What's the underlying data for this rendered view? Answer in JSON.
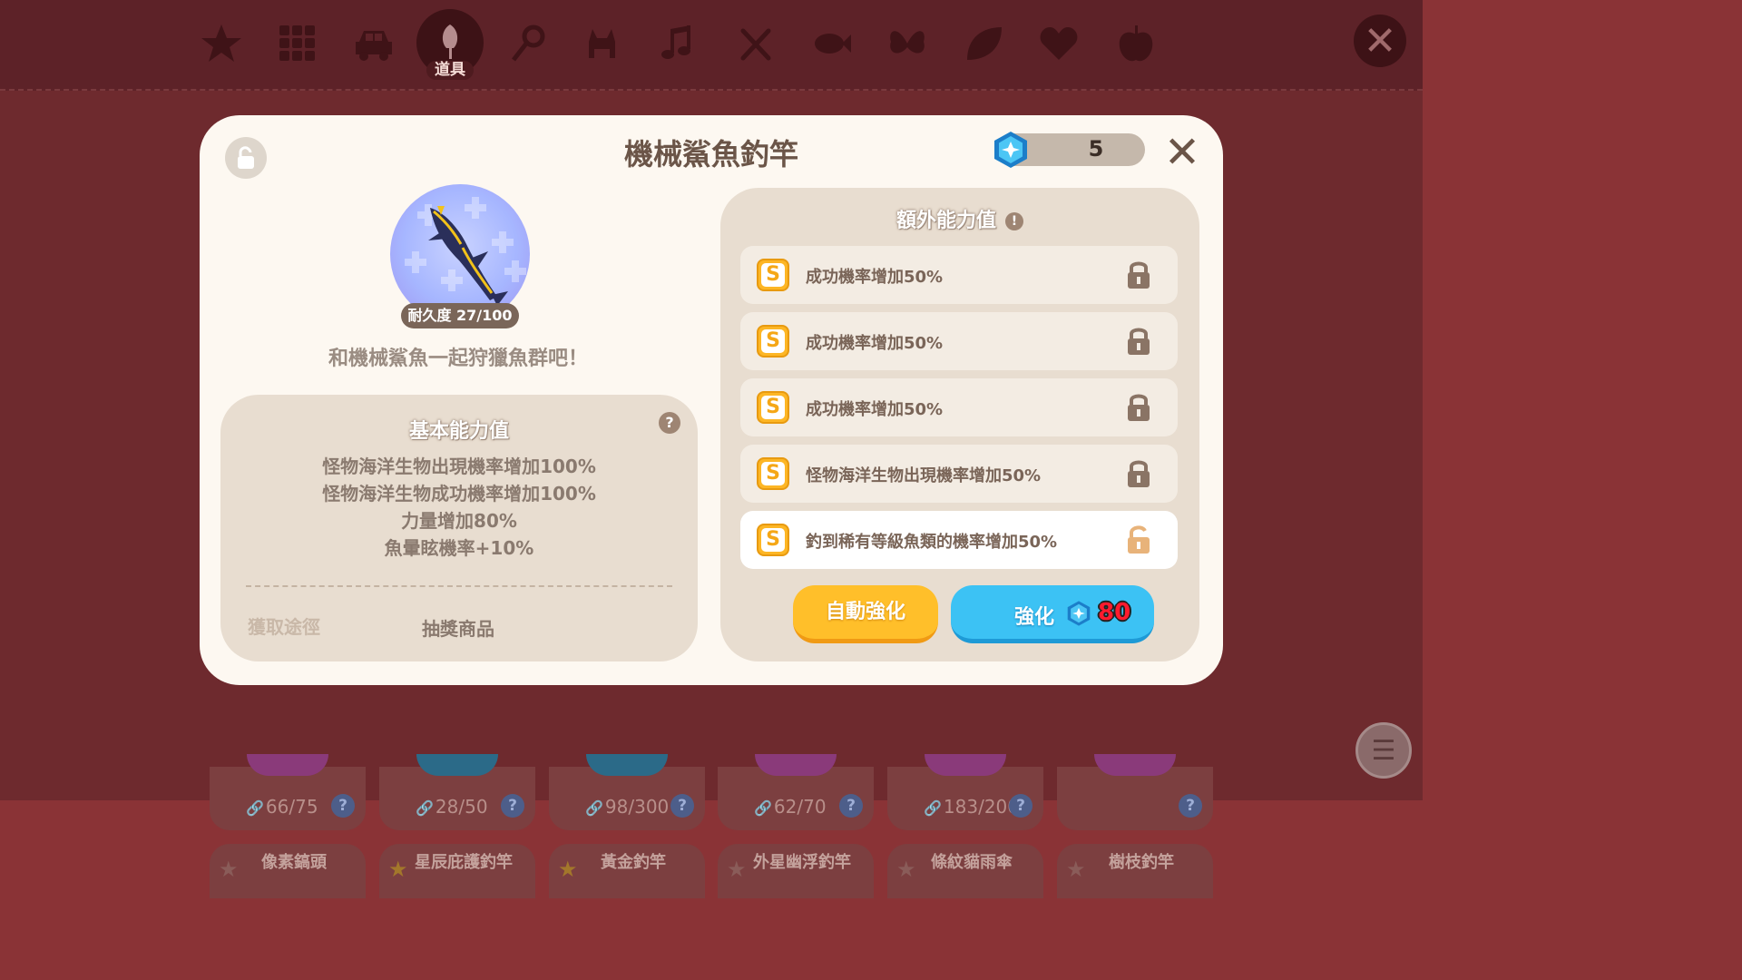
{
  "categories": {
    "active_label": "道具"
  },
  "inventory": {
    "cards": [
      {
        "durability": "66/75",
        "orb_color": "#8a3a7a"
      },
      {
        "durability": "28/50",
        "orb_color": "#2b6a88"
      },
      {
        "durability": "98/300",
        "orb_color": "#2b6a88"
      },
      {
        "durability": "62/70",
        "orb_color": "#8a3a7a"
      },
      {
        "durability": "183/200",
        "orb_color": "#8a3a7a"
      },
      {
        "durability": "",
        "orb_color": "#8a3a7a"
      }
    ],
    "names": [
      {
        "label": "像素鎬頭",
        "star": "gray"
      },
      {
        "label": "星辰庇護釣竿",
        "star": "gold"
      },
      {
        "label": "黃金釣竿",
        "star": "gold"
      },
      {
        "label": "外星幽浮釣竿",
        "star": "gray"
      },
      {
        "label": "條紋貓雨傘",
        "star": "gray"
      },
      {
        "label": "樹枝釣竿",
        "star": "gray"
      }
    ],
    "help_icon": "?"
  },
  "modal": {
    "title": "機械鯊魚釣竿",
    "gem_count": "5",
    "durability": "耐久度 27/100",
    "tagline": "和機械鯊魚一起狩獵魚群吧！",
    "basic": {
      "title": "基本能力值",
      "help": "?",
      "stats": [
        "怪物海洋生物出現機率增加100%",
        "怪物海洋生物成功機率增加100%",
        "力量增加80%",
        "魚暈眩機率+10%"
      ],
      "source_label": "獲取途徑",
      "source_value": "抽獎商品"
    },
    "extra": {
      "title": "額外能力值",
      "warn": "!",
      "rows": [
        {
          "grade": "S",
          "text": "成功機率增加50%",
          "locked": true
        },
        {
          "grade": "S",
          "text": "成功機率增加50%",
          "locked": true
        },
        {
          "grade": "S",
          "text": "成功機率增加50%",
          "locked": true
        },
        {
          "grade": "S",
          "text": "怪物海洋生物出現機率增加50%",
          "locked": true
        },
        {
          "grade": "S",
          "text": "釣到稀有等級魚類的機率增加50%",
          "locked": false
        }
      ]
    },
    "buttons": {
      "auto_enhance": "自動強化",
      "enhance": "強化",
      "enhance_cost": "80"
    }
  },
  "colors": {
    "accent_yellow": "#ffbf2a",
    "accent_blue": "#3cc2f4",
    "cost_red": "#ff1b2e",
    "background": "#6e2a2e"
  }
}
